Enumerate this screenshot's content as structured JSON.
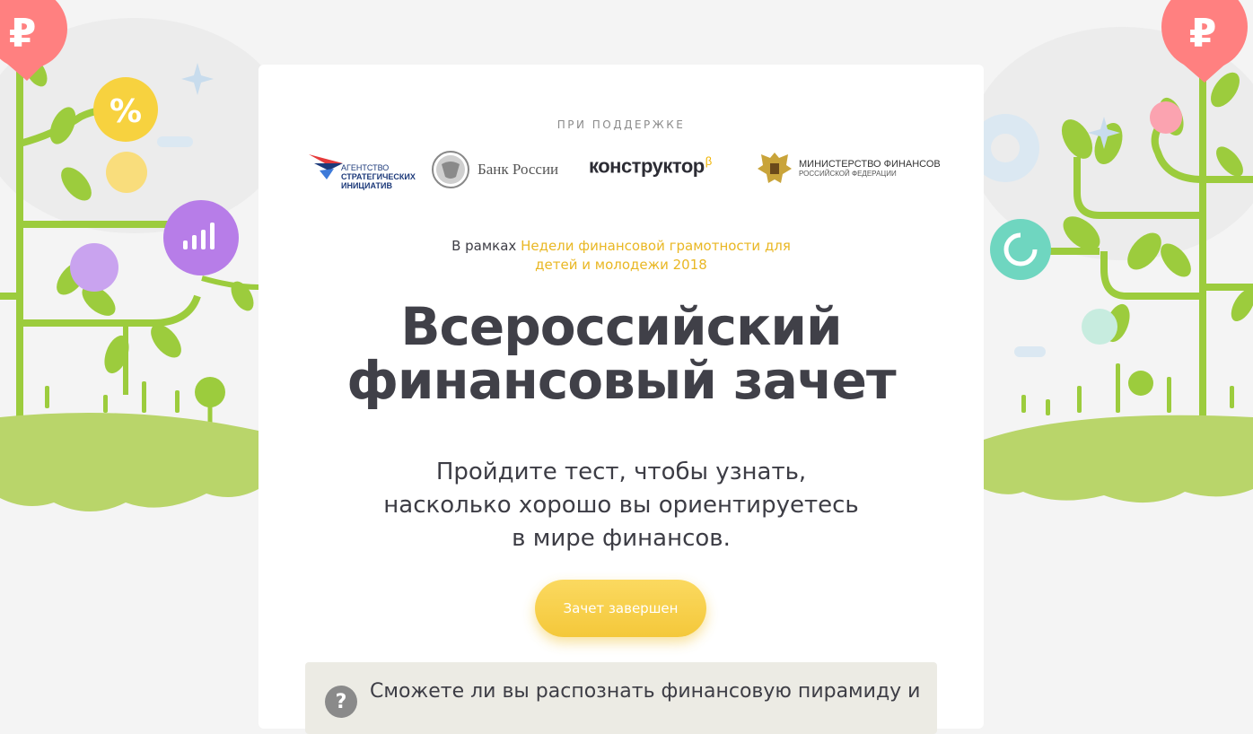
{
  "support": {
    "label": "ПРИ ПОДДЕРЖКЕ"
  },
  "partners": {
    "asi": {
      "line1": "АГЕНТСТВО",
      "line2": "СТРАТЕГИЧЕСКИХ",
      "line3": "ИНИЦИАТИВ"
    },
    "bank": {
      "name": "Банк России"
    },
    "konstruktor": {
      "name": "конструктор",
      "mark": "β"
    },
    "minfin": {
      "title": "МИНИСТЕРСТВО ФИНАНСОВ",
      "subtitle": "РОССИЙСКОЙ ФЕДЕРАЦИИ"
    }
  },
  "frame": {
    "prefix": "В рамках ",
    "event_line1": "Недели финансовой грамотности для",
    "event_line2": "детей и молодежи 2018"
  },
  "hero": {
    "title_line1": "Всероссийский",
    "title_line2": "финансовый зачет",
    "lead_line1": "Пройдите тест, чтобы узнать,",
    "lead_line2": "насколько хорошо вы ориентируетесь",
    "lead_line3": "в мире финансов.",
    "button_label": "Зачет завершен"
  },
  "question": {
    "icon": "?",
    "text": "Сможете ли вы распознать финансовую пирамиду и"
  },
  "decor": {
    "left_badges": [
      "₽",
      "%",
      "chart-icon"
    ],
    "right_badges": [
      "₽",
      "refresh-icon"
    ]
  },
  "colors": {
    "accent_yellow": "#f4c83a",
    "grass_green": "#b9d56a",
    "leaf_green": "#9ccc3d",
    "ruble_pink": "#ff7b7b",
    "percent_yellow": "#f7d23f",
    "chart_purple": "#b77de8",
    "teal": "#6fd6c0"
  }
}
